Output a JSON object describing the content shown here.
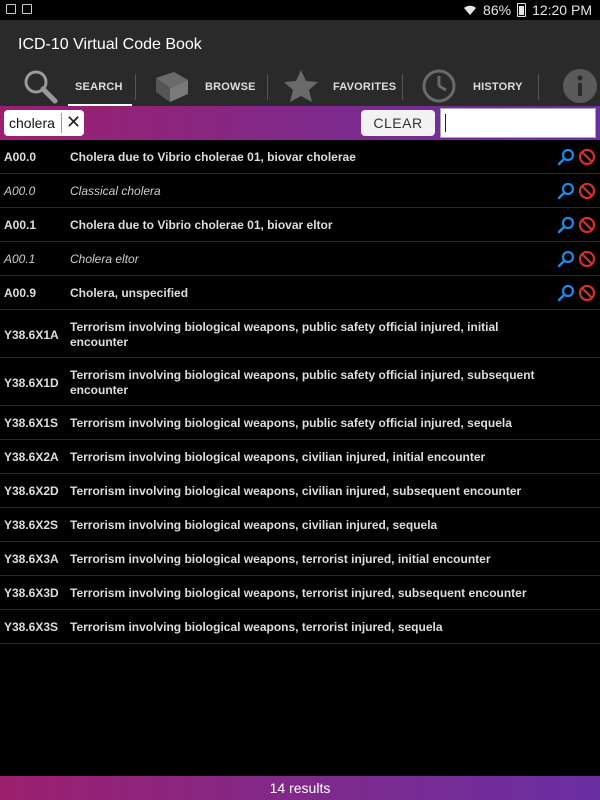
{
  "status": {
    "battery": "86%",
    "time": "12:20 PM"
  },
  "app": {
    "title": "ICD-10 Virtual Code Book"
  },
  "tabs": [
    {
      "label": "SEARCH",
      "icon": "magnifier-icon",
      "active": true
    },
    {
      "label": "BROWSE",
      "icon": "book-icon",
      "active": false
    },
    {
      "label": "FAVORITES",
      "icon": "star-icon",
      "active": false
    },
    {
      "label": "HISTORY",
      "icon": "clock-icon",
      "active": false
    },
    {
      "label": "",
      "icon": "info-icon",
      "active": false
    }
  ],
  "search": {
    "term": "cholera",
    "clear_label": "CLEAR",
    "input_value": ""
  },
  "results": [
    {
      "code": "A00.0",
      "desc": "Cholera due to Vibrio cholerae 01, biovar cholerae",
      "style": "bold",
      "actions": true
    },
    {
      "code": "A00.0",
      "desc": "Classical cholera",
      "style": "italic",
      "actions": true
    },
    {
      "code": "A00.1",
      "desc": "Cholera due to Vibrio cholerae 01, biovar eltor",
      "style": "bold",
      "actions": true
    },
    {
      "code": "A00.1",
      "desc": "Cholera eltor",
      "style": "italic",
      "actions": true
    },
    {
      "code": "A00.9",
      "desc": "Cholera, unspecified",
      "style": "bold",
      "actions": true
    },
    {
      "code": "Y38.6X1A",
      "desc": "Terrorism involving biological weapons, public safety official injured, initial encounter",
      "style": "bold",
      "actions": false
    },
    {
      "code": "Y38.6X1D",
      "desc": "Terrorism involving biological weapons, public safety official injured, subsequent encounter",
      "style": "bold",
      "actions": false
    },
    {
      "code": "Y38.6X1S",
      "desc": "Terrorism involving biological weapons, public safety official injured, sequela",
      "style": "bold",
      "actions": false
    },
    {
      "code": "Y38.6X2A",
      "desc": "Terrorism involving biological weapons, civilian injured, initial encounter",
      "style": "bold",
      "actions": false
    },
    {
      "code": "Y38.6X2D",
      "desc": "Terrorism involving biological weapons, civilian injured, subsequent encounter",
      "style": "bold",
      "actions": false
    },
    {
      "code": "Y38.6X2S",
      "desc": "Terrorism involving biological weapons, civilian injured, sequela",
      "style": "bold",
      "actions": false
    },
    {
      "code": "Y38.6X3A",
      "desc": "Terrorism involving biological weapons, terrorist injured, initial encounter",
      "style": "bold",
      "actions": false
    },
    {
      "code": "Y38.6X3D",
      "desc": "Terrorism involving biological weapons, terrorist injured, subsequent encounter",
      "style": "bold",
      "actions": false
    },
    {
      "code": "Y38.6X3S",
      "desc": "Terrorism involving biological weapons, terrorist injured, sequela",
      "style": "bold",
      "actions": false
    }
  ],
  "footer": {
    "count_text": "14 results"
  },
  "colors": {
    "accent_start": "#9c1f6e",
    "accent_end": "#6a2ea3",
    "appbar": "#2a2a2a",
    "lookup_icon": "#1e88e5",
    "exclude_icon": "#d32f2f"
  }
}
